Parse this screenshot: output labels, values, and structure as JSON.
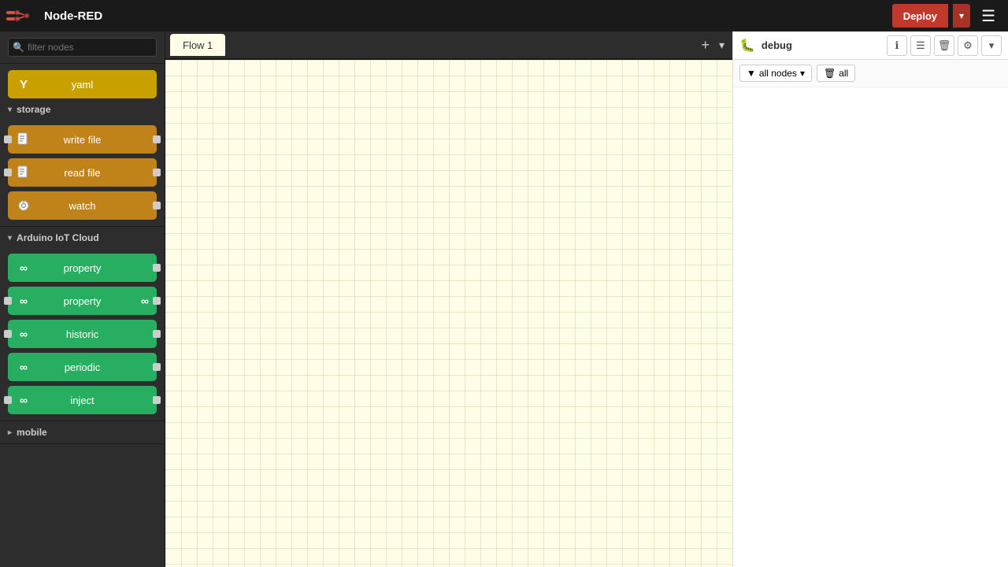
{
  "app": {
    "title": "Node-RED",
    "logo_symbol": "⬡"
  },
  "topbar": {
    "deploy_label": "Deploy",
    "hamburger": "☰"
  },
  "sidebar": {
    "filter_placeholder": "filter nodes",
    "categories": [
      {
        "id": "storage",
        "label": "storage",
        "expanded": true,
        "nodes": [
          {
            "id": "yaml",
            "label": "yaml",
            "color": "yellow",
            "icon": "Y",
            "has_left": false,
            "has_right": false
          },
          {
            "id": "write-file",
            "label": "write file",
            "color": "orange",
            "icon": "📄",
            "has_left": true,
            "has_right": true
          },
          {
            "id": "read-file",
            "label": "read file",
            "color": "orange",
            "icon": "📄",
            "has_left": true,
            "has_right": true
          },
          {
            "id": "watch",
            "label": "watch",
            "color": "orange",
            "icon": "🔍",
            "has_left": false,
            "has_right": true
          }
        ]
      },
      {
        "id": "arduino-iot-cloud",
        "label": "Arduino IoT Cloud",
        "expanded": true,
        "nodes": [
          {
            "id": "property-out",
            "label": "property",
            "color": "green",
            "icon": "∞",
            "has_left": false,
            "has_right": true
          },
          {
            "id": "property-in",
            "label": "property",
            "color": "green",
            "icon": "∞",
            "has_left": true,
            "has_right": true,
            "icon_right": "∞"
          },
          {
            "id": "historic",
            "label": "historic",
            "color": "green",
            "icon": "∞",
            "has_left": true,
            "has_right": true
          },
          {
            "id": "periodic",
            "label": "periodic",
            "color": "green",
            "icon": "∞",
            "has_left": false,
            "has_right": true
          },
          {
            "id": "inject",
            "label": "inject",
            "color": "green",
            "icon": "∞",
            "has_left": true,
            "has_right": true
          }
        ]
      },
      {
        "id": "mobile",
        "label": "mobile",
        "expanded": false,
        "nodes": []
      }
    ]
  },
  "flow": {
    "tab_label": "Flow 1"
  },
  "debug_panel": {
    "title": "debug",
    "filter_label": "all nodes",
    "clear_label": "all",
    "btn_info": "ℹ",
    "btn_list": "☰",
    "btn_trash": "🗑",
    "btn_gear": "⚙"
  }
}
